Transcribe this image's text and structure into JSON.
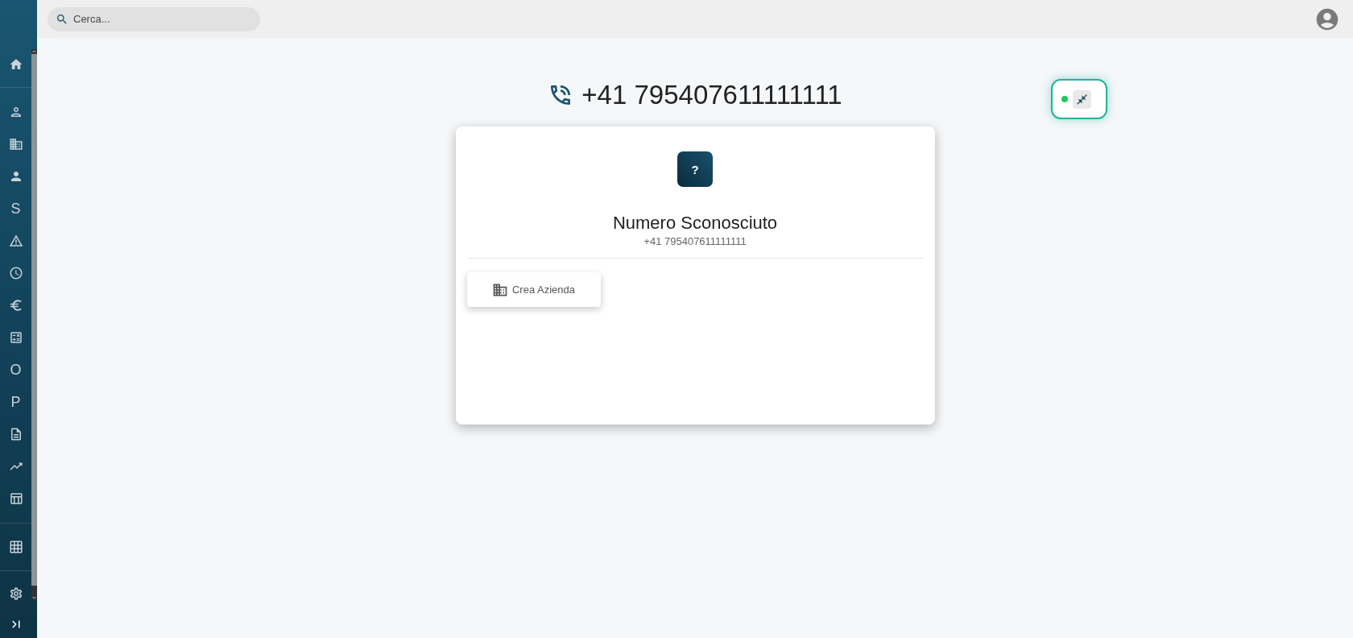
{
  "sidebar": {
    "sections": [
      {
        "items": [
          {
            "kind": "icon"
          }
        ]
      },
      {
        "items": [
          {
            "kind": "icon"
          },
          {
            "kind": "icon"
          },
          {
            "kind": "icon"
          },
          {
            "kind": "letter",
            "label": "S"
          },
          {
            "kind": "icon"
          },
          {
            "kind": "icon"
          },
          {
            "kind": "icon"
          },
          {
            "kind": "icon"
          },
          {
            "kind": "letter",
            "label": "O"
          },
          {
            "kind": "letter",
            "label": "P"
          },
          {
            "kind": "icon"
          },
          {
            "kind": "icon"
          },
          {
            "kind": "icon"
          }
        ]
      },
      {
        "items": [
          {
            "kind": "icon"
          }
        ]
      },
      {
        "items": [
          {
            "kind": "icon"
          }
        ]
      }
    ]
  },
  "top_bar": {
    "search": {
      "placeholder": "Cerca..."
    }
  },
  "call_header": {
    "number": "+41 795407611111111"
  },
  "call_widget": {
    "connected": true
  },
  "contact_card": {
    "avatar": "?",
    "title": "Numero Sconosciuto",
    "subtitle": "+41 795407611111111",
    "actions": [
      {
        "label": "Crea Azienda"
      }
    ]
  }
}
